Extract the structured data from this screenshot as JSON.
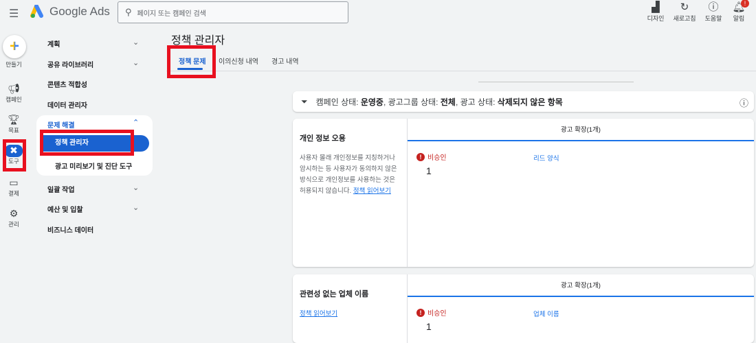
{
  "header": {
    "product": "Google Ads",
    "search_placeholder": "페이지 또는 캠페인 검색",
    "tools": [
      "디자인",
      "새로고침",
      "도움말",
      "알림"
    ],
    "notification_badge": "!"
  },
  "rail": {
    "create": "만들기",
    "items": [
      "캠페인",
      "목표",
      "도구",
      "결제",
      "관리"
    ]
  },
  "nav": {
    "items": [
      "계획",
      "공유 라이브러리",
      "콘텐츠 적합성",
      "데이터 관리자"
    ],
    "group": "문제 해결",
    "active": "정책 관리자",
    "sub": "광고 미리보기 및 진단 도구",
    "after": [
      "일괄 작업",
      "예산 및 입찰",
      "비즈니스 데이터"
    ]
  },
  "page": {
    "title": "정책 관리자",
    "tabs": [
      "정책 문제",
      "이의신청 내역",
      "경고 내역"
    ]
  },
  "filter": {
    "l1": "캠페인 상태: ",
    "v1": "운영중",
    "l2": ", 광고그룹 상태: ",
    "v2": "전체",
    "l3": ", 광고 상태: ",
    "v3": "삭제되지 않은 항목"
  },
  "cards": [
    {
      "title": "개인 정보 오용",
      "desc": "사용자 몰래 개인정보를 지칭하거나 암시하는 등 사용자가 동의하지 않은 방식으로 개인정보를 사용하는 것은 허용되지 않습니다. ",
      "link": "정책 읽어보기",
      "header": "광고 확장(1개)",
      "status": "비승인",
      "count": "1",
      "type": "리드 양식"
    },
    {
      "title": "관련성 없는 업체 이름",
      "link": "정책 읽어보기",
      "header": "광고 확장(1개)",
      "status": "비승인",
      "count": "1",
      "type": "업체 이름"
    }
  ],
  "colors": {
    "accent": "#1a73e8",
    "error": "#c5221f",
    "highlight": "#e8101f"
  }
}
